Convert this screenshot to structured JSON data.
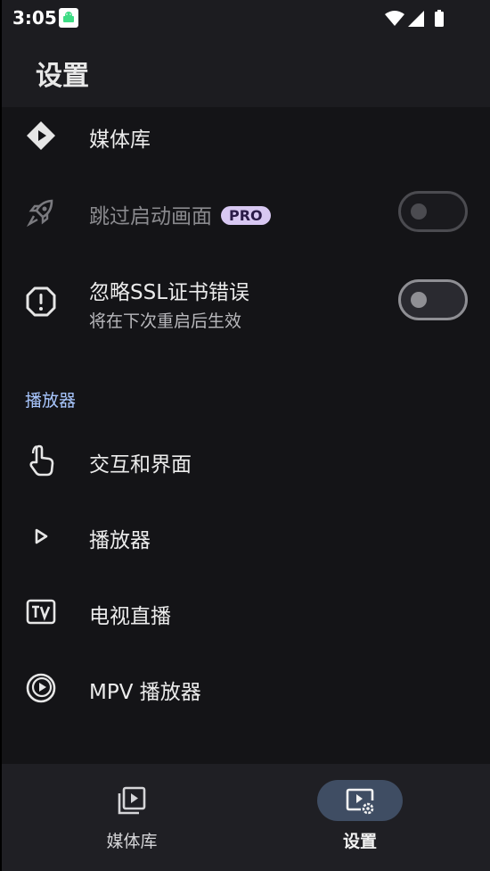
{
  "status_bar": {
    "time": "3:05"
  },
  "app_bar": {
    "title": "设置"
  },
  "settings": {
    "media_library": {
      "label": "媒体库"
    },
    "skip_splash": {
      "label": "跳过启动画面",
      "badge": "PRO",
      "enabled": false,
      "checked": false
    },
    "ignore_ssl": {
      "label": "忽略SSL证书错误",
      "subtitle": "将在下次重启后生效",
      "checked": false
    }
  },
  "player_section": {
    "header": "播放器",
    "items": [
      {
        "label": "交互和界面",
        "icon": "touch-icon"
      },
      {
        "label": "播放器",
        "icon": "play-arrow-icon"
      },
      {
        "label": "电视直播",
        "icon": "tv-icon"
      },
      {
        "label": "MPV 播放器",
        "icon": "mpv-icon"
      }
    ]
  },
  "bottom_nav": {
    "items": [
      {
        "label": "媒体库",
        "icon": "video-library-icon",
        "active": false
      },
      {
        "label": "设置",
        "icon": "video-settings-icon",
        "active": true
      }
    ]
  },
  "colors": {
    "accent": "#a9c7ff",
    "background": "#141417",
    "badge": "#d8c8f2"
  }
}
